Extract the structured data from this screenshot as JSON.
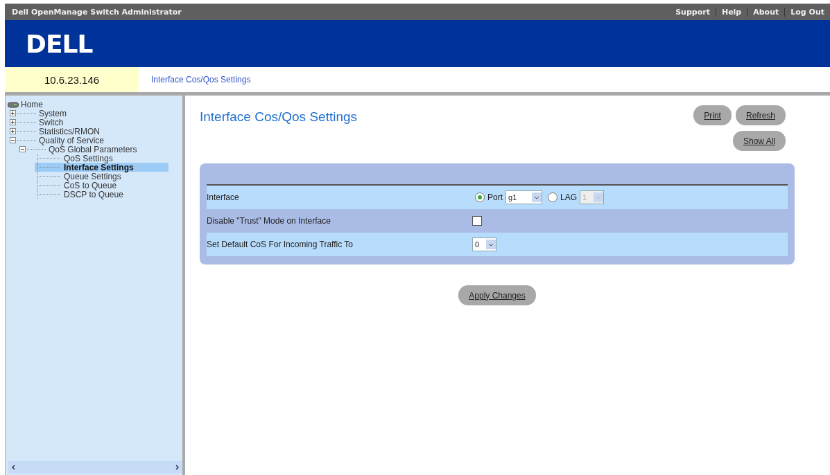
{
  "window": {
    "title": "Dell OpenManage Switch Administrator"
  },
  "top_links": [
    "Support",
    "Help",
    "About",
    "Log Out"
  ],
  "logo": "DELL",
  "address": "10.6.23.146",
  "breadcrumb": "Interface Cos/Qos Settings",
  "tree": {
    "label": "Home",
    "children": [
      {
        "label": "System",
        "expanded": false,
        "selected": false
      },
      {
        "label": "Switch",
        "expanded": false,
        "selected": false
      },
      {
        "label": "Statistics/RMON",
        "expanded": false,
        "selected": false
      },
      {
        "label": "Quality of Service",
        "expanded": true,
        "selected": false,
        "children": [
          {
            "label": "QoS Global Parameters",
            "expanded": true,
            "selected": false,
            "children": [
              {
                "label": "QoS Settings",
                "selected": false
              },
              {
                "label": "Interface Settings",
                "selected": true
              },
              {
                "label": "Queue Settings",
                "selected": false
              },
              {
                "label": "CoS to Queue",
                "selected": false
              },
              {
                "label": "DSCP to Queue",
                "selected": false
              }
            ]
          }
        ]
      }
    ]
  },
  "page_title": "Interface Cos/Qos Settings",
  "header_buttons": [
    "Print",
    "Refresh",
    "Show All"
  ],
  "form_rows": [
    {
      "kind": "interface",
      "label": "Interface",
      "options": [
        {
          "label": "Port",
          "selected": true,
          "value": "g1",
          "disabled": false
        },
        {
          "label": "LAG",
          "selected": false,
          "value": "1",
          "disabled": true
        }
      ]
    },
    {
      "kind": "checkbox",
      "label": "Disable \"Trust\" Mode on Interface",
      "checked": false
    },
    {
      "kind": "select",
      "label": "Set Default CoS For Incoming Traffic To",
      "value": "0"
    }
  ],
  "apply_button": "Apply Changes"
}
